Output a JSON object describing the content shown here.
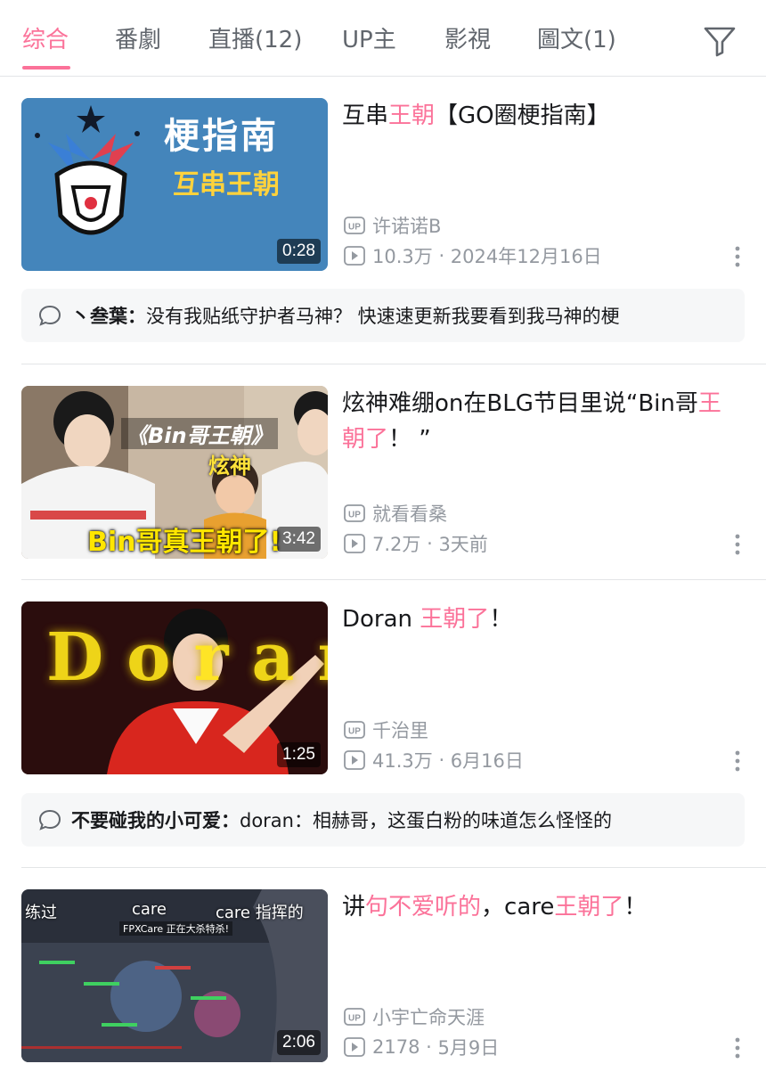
{
  "tabs": [
    {
      "label": "综合",
      "active": true
    },
    {
      "label": "番劇"
    },
    {
      "label": "直播(12)"
    },
    {
      "label": "UP主"
    },
    {
      "label": "影視"
    },
    {
      "label": "圖文(1)"
    }
  ],
  "filter_icon": "filter-funnel-icon",
  "accent_color": "#fb7299",
  "results": [
    {
      "title_parts": [
        "互串",
        "王朝",
        "【GO圈梗指南】"
      ],
      "highlight": [
        false,
        true,
        false
      ],
      "thumb_text": {
        "line1": "梗指南",
        "line2": "互串王朝"
      },
      "duration": "0:28",
      "uploader": "许诺诺B",
      "views": "10.3万",
      "date": "2024年12月16日",
      "comment": {
        "user": "丶叁葉：",
        "text": "没有我贴纸守护者马神？ 快速速更新我要看到我马神的梗"
      }
    },
    {
      "title_parts": [
        "炫神难绷on在BLG节目里说“Bin哥",
        "王朝了",
        "！ ”"
      ],
      "highlight": [
        false,
        true,
        false
      ],
      "thumb_text": {
        "line1": "《Bin哥王朝》",
        "line2": "炫神",
        "line3": "Bin哥真王朝了!"
      },
      "duration": "3:42",
      "uploader": "就看看桑",
      "views": "7.2万",
      "date": "3天前"
    },
    {
      "title_parts": [
        "Doran ",
        "王朝了",
        "！"
      ],
      "highlight": [
        false,
        true,
        false
      ],
      "thumb_text": {
        "line1": "Doran"
      },
      "duration": "1:25",
      "uploader": "千治里",
      "views": "41.3万",
      "date": "6月16日",
      "comment": {
        "user": "不要碰我的小可爱：",
        "text": "doran：相赫哥，这蛋白粉的味道怎么怪怪的"
      }
    },
    {
      "title_parts": [
        "讲",
        "句不爱听的",
        "，care",
        "王朝了",
        "！"
      ],
      "highlight": [
        false,
        true,
        false,
        true,
        false
      ],
      "thumb_text": {
        "line1": "练过",
        "line2": "care",
        "line3": "care 指挥的",
        "line4": "FPXCare 正在大杀特杀!"
      },
      "duration": "2:06",
      "uploader": "小宇亡命天涯",
      "views": "2178",
      "date": "5月9日"
    }
  ],
  "separator": " · "
}
